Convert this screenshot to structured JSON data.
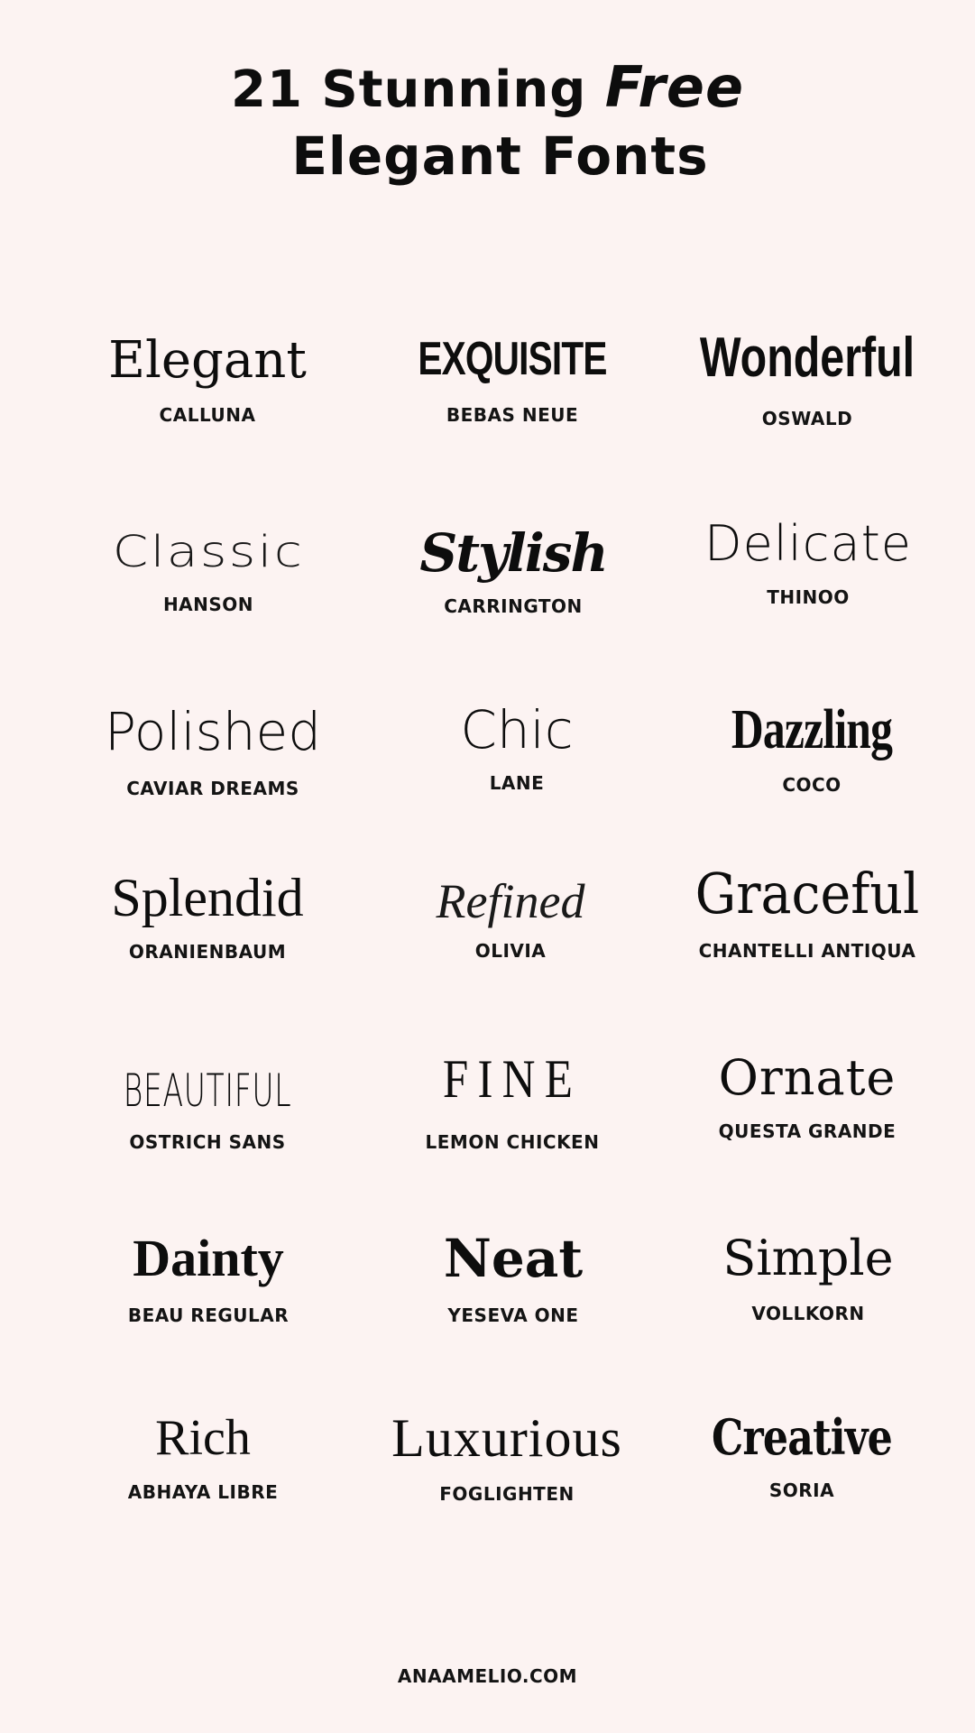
{
  "header": {
    "title_line1_part1": "21 Stunning",
    "title_line1_part2": "Free",
    "title_line2": "Elegant Fonts"
  },
  "fonts": [
    {
      "sample": "Elegant",
      "name": "CALLUNA"
    },
    {
      "sample": "EXQUISITE",
      "name": "BEBAS NEUE"
    },
    {
      "sample": "Wonderful",
      "name": "OSWALD"
    },
    {
      "sample": "Classic",
      "name": "HANSON"
    },
    {
      "sample": "Stylish",
      "name": "CARRINGTON"
    },
    {
      "sample": "Delicate",
      "name": "THINOO"
    },
    {
      "sample": "Polished",
      "name": "CAVIAR DREAMS"
    },
    {
      "sample": "Chic",
      "name": "LANE"
    },
    {
      "sample": "Dazzling",
      "name": "COCO"
    },
    {
      "sample": "Splendid",
      "name": "ORANIENBAUM"
    },
    {
      "sample": "Refined",
      "name": "OLIVIA"
    },
    {
      "sample": "Graceful",
      "name": "CHANTELLI ANTIQUA"
    },
    {
      "sample": "BEAUTIFUL",
      "name": "OSTRICH SANS"
    },
    {
      "sample": "FINE",
      "name": "LEMON CHICKEN"
    },
    {
      "sample": "Ornate",
      "name": "QUESTA GRANDE"
    },
    {
      "sample": "Dainty",
      "name": "BEAU REGULAR"
    },
    {
      "sample": "Neat",
      "name": "YESEVA ONE"
    },
    {
      "sample": "Simple",
      "name": "VOLLKORN"
    },
    {
      "sample": "Rich",
      "name": "ABHAYA LIBRE"
    },
    {
      "sample": "Luxurious",
      "name": "FOGLIGHTEN"
    },
    {
      "sample": "Creative",
      "name": "SORIA"
    }
  ],
  "footer": {
    "website": "ANAAMELIO.COM"
  }
}
